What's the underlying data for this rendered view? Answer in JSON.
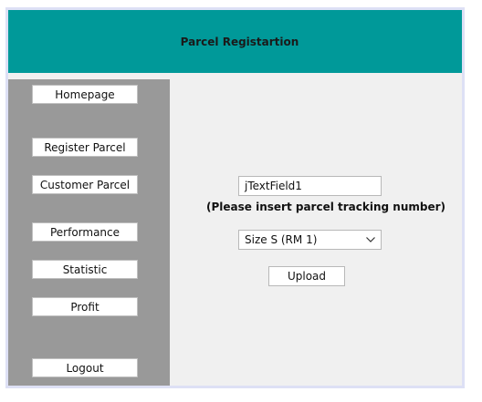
{
  "header": {
    "title": "Parcel Registartion",
    "background": "#009999"
  },
  "sidebar": {
    "background": "#999999",
    "items": [
      {
        "label": "Homepage"
      },
      {
        "label": "Register Parcel"
      },
      {
        "label": "Customer Parcel"
      },
      {
        "label": "Performance"
      },
      {
        "label": "Statistic"
      },
      {
        "label": "Profit"
      },
      {
        "label": "Logout"
      }
    ]
  },
  "form": {
    "tracking_field_value": "jTextField1",
    "hint": "(Please insert parcel tracking number)",
    "size_select": {
      "selected": "Size S (RM 1)",
      "icon": "chevron-down-icon"
    },
    "upload_label": "Upload"
  }
}
